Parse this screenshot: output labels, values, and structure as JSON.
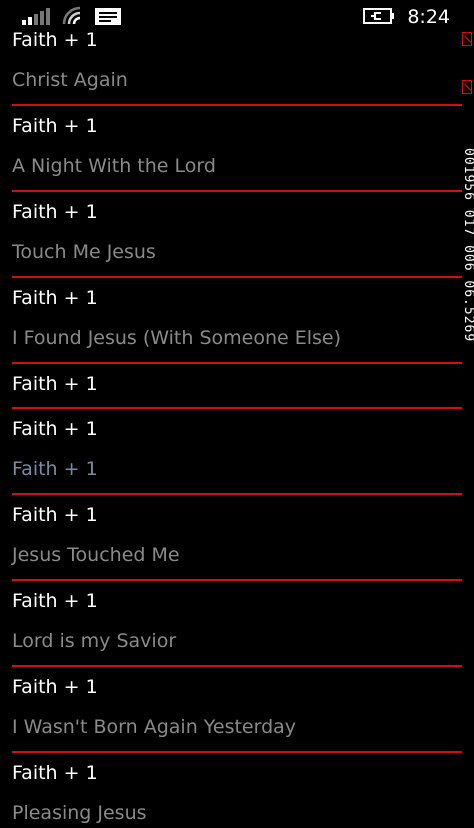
{
  "status": {
    "time": "8:24",
    "signal_icon": "signal-bars-icon",
    "wifi_icon": "wifi-icon",
    "message_icon": "message-icon",
    "battery_icon": "battery-charging-icon"
  },
  "rail_text": "001956 017 006 06.5269",
  "songs": [
    {
      "artist": "Faith + 1",
      "title": "Christ Again"
    },
    {
      "artist": "Faith + 1",
      "title": "A Night With the Lord"
    },
    {
      "artist": "Faith + 1",
      "title": "Touch Me Jesus"
    },
    {
      "artist": "Faith + 1",
      "title": "I Found Jesus (With Someone Else)"
    },
    {
      "artist": "Faith + 1",
      "title": ""
    },
    {
      "artist": "Faith + 1",
      "title": "Faith + 1"
    },
    {
      "artist": "Faith + 1",
      "title": "Jesus Touched Me"
    },
    {
      "artist": "Faith + 1",
      "title": "Lord is my Savior"
    },
    {
      "artist": "Faith + 1",
      "title": "I Wasn't Born Again Yesterday"
    },
    {
      "artist": "Faith + 1",
      "title": "Pleasing Jesus"
    }
  ]
}
